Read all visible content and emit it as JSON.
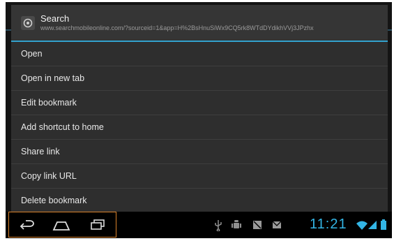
{
  "dialog": {
    "title": "Search",
    "url": "www.searchmobileonline.com/?sourceid=1&app=H%2BsHnuSiWx9CQ5rk8WTdDYdikhVVj3JPzhx",
    "icon": "browser-favicon-icon",
    "menu_items": [
      "Open",
      "Open in new tab",
      "Edit bookmark",
      "Add shortcut to home",
      "Share link",
      "Copy link URL",
      "Delete bookmark"
    ]
  },
  "navbar": {
    "buttons": [
      "back-icon",
      "home-icon",
      "recent-apps-icon"
    ],
    "status_icons": [
      "usb-icon",
      "android-debug-icon",
      "screenshot-icon",
      "email-icon",
      "wifi-icon",
      "signal-icon",
      "battery-icon"
    ],
    "time": "11:21"
  },
  "colors": {
    "accent": "#33b5e5",
    "highlight_box": "#d9822b",
    "dialog_bg": "#2e2e2e"
  }
}
